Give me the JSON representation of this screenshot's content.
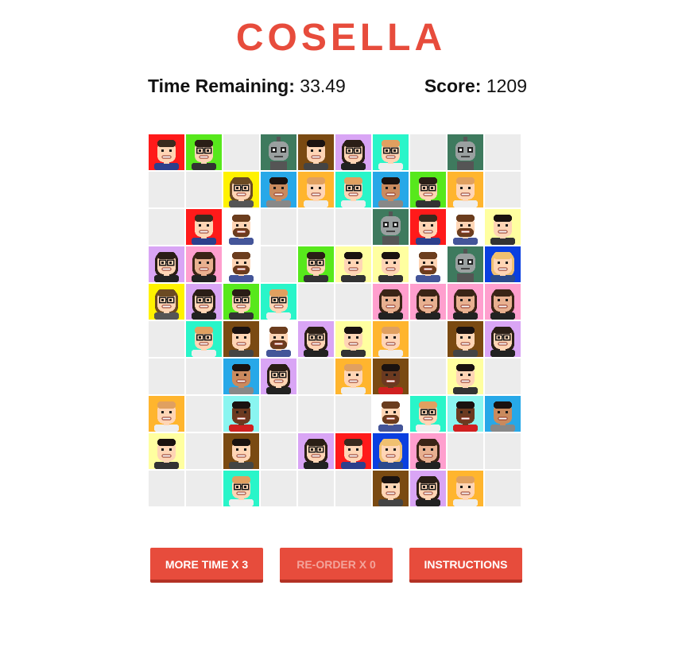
{
  "title": "COSELLA",
  "stats": {
    "time_label": "Time Remaining:",
    "time_value": "33.49",
    "score_label": "Score:",
    "score_value": "1209"
  },
  "buttons": {
    "more_time": "MORE TIME X 3",
    "reorder": "RE-ORDER X 0",
    "instructions": "INSTRUCTIONS"
  },
  "avatars": {
    "A": {
      "bg": "#ff1a1a",
      "skin": "#ffd5b5",
      "hair": "#3a2a1e",
      "shirt": "#2d3f8c",
      "glasses": false,
      "beard": false,
      "robot": false,
      "longhair": false,
      "name": "bald-guy-red-avatar"
    },
    "B": {
      "bg": "#57e81c",
      "skin": "#ffd5b5",
      "hair": "#2a1e16",
      "shirt": "#333333",
      "glasses": true,
      "beard": false,
      "robot": false,
      "longhair": false,
      "name": "glasses-guy-green-avatar"
    },
    "C": {
      "bg": "#3e7a5e",
      "skin": "#9aa0a0",
      "hair": "#6b6b6b",
      "shirt": "#555555",
      "glasses": false,
      "beard": false,
      "robot": true,
      "longhair": false,
      "name": "robot-avatar"
    },
    "D": {
      "bg": "#7a4a12",
      "skin": "#ffd5b5",
      "hair": "#1a1210",
      "shirt": "#444444",
      "glasses": false,
      "beard": false,
      "robot": false,
      "longhair": false,
      "name": "spiky-hair-guy-brown-avatar"
    },
    "E": {
      "bg": "#d9a5f5",
      "skin": "#ffd5b5",
      "hair": "#2a1e16",
      "shirt": "#222222",
      "glasses": true,
      "beard": false,
      "robot": false,
      "longhair": true,
      "name": "glasses-woman-purple-avatar"
    },
    "F": {
      "bg": "#29f5c9",
      "skin": "#ffd5b5",
      "hair": "#e0a060",
      "shirt": "#eeeeee",
      "glasses": true,
      "beard": false,
      "robot": false,
      "longhair": false,
      "name": "ginger-glasses-guy-teal-avatar"
    },
    "G": {
      "bg": "#fff200",
      "skin": "#ffd5b5",
      "hair": "#6b4a22",
      "shirt": "#555555",
      "glasses": true,
      "beard": false,
      "robot": false,
      "longhair": true,
      "name": "curly-woman-yellow-avatar"
    },
    "H": {
      "bg": "#27a8e8",
      "skin": "#c98a5e",
      "hair": "#1a1210",
      "shirt": "#888888",
      "glasses": false,
      "beard": false,
      "robot": false,
      "longhair": false,
      "name": "tan-guy-blue-avatar"
    },
    "I": {
      "bg": "#ffb52e",
      "skin": "#ffd5b5",
      "hair": "#e0a060",
      "shirt": "#eeeeee",
      "glasses": false,
      "beard": false,
      "robot": false,
      "longhair": false,
      "name": "blond-guy-orange-avatar"
    },
    "J": {
      "bg": "#ffffff",
      "skin": "#ffd5b5",
      "hair": "#6b3d1e",
      "shirt": "#445599",
      "glasses": false,
      "beard": true,
      "robot": false,
      "longhair": false,
      "name": "bearded-guy-white-avatar"
    },
    "K": {
      "bg": "#ffffa0",
      "skin": "#ffd5b5",
      "hair": "#1a1210",
      "shirt": "#333333",
      "glasses": false,
      "beard": false,
      "robot": false,
      "longhair": false,
      "name": "dark-hair-guy-cream-avatar"
    },
    "L": {
      "bg": "#ff9fce",
      "skin": "#e8b090",
      "hair": "#3a2416",
      "shirt": "#222222",
      "glasses": false,
      "beard": false,
      "robot": false,
      "longhair": true,
      "name": "long-hair-woman-pink-avatar"
    },
    "M": {
      "bg": "#0a3fe0",
      "skin": "#ffd5b5",
      "hair": "#f0c070",
      "shirt": "#2a4a8c",
      "glasses": false,
      "beard": false,
      "robot": false,
      "longhair": true,
      "name": "blonde-woman-blue-avatar"
    },
    "N": {
      "bg": "#7a4a12",
      "skin": "#6b3a20",
      "hair": "#1a1210",
      "shirt": "#d02020",
      "glasses": false,
      "beard": false,
      "robot": false,
      "longhair": false,
      "name": "dark-skin-guy-brown-avatar"
    },
    "O": {
      "bg": "#8af5f0",
      "skin": "#6b3a20",
      "hair": "#1a1210",
      "shirt": "#d02020",
      "glasses": false,
      "beard": false,
      "robot": false,
      "longhair": false,
      "name": "dark-skin-guy-cyan-avatar"
    }
  },
  "grid": [
    [
      "A",
      "B",
      "",
      "C",
      "D",
      "E",
      "F",
      "",
      "C",
      ""
    ],
    [
      "",
      "",
      "G",
      "H",
      "I",
      "F",
      "H",
      "B",
      "I",
      ""
    ],
    [
      "",
      "A",
      "J",
      "",
      "",
      "",
      "C",
      "A",
      "J",
      "K"
    ],
    [
      "E",
      "L",
      "J",
      "",
      "B",
      "K",
      "K",
      "J",
      "C",
      "M"
    ],
    [
      "G",
      "E",
      "B",
      "F",
      "",
      "",
      "L",
      "L",
      "L",
      "L"
    ],
    [
      "",
      "F",
      "D",
      "J",
      "E",
      "K",
      "I",
      "",
      "D",
      "E"
    ],
    [
      "",
      "",
      "H",
      "E",
      "",
      "I",
      "N",
      "",
      "K",
      ""
    ],
    [
      "I",
      "",
      "O",
      "",
      "",
      "",
      "J",
      "F",
      "O",
      "H"
    ],
    [
      "K",
      "",
      "D",
      "",
      "E",
      "A",
      "M",
      "L",
      "",
      ""
    ],
    [
      "",
      "",
      "F",
      "",
      "",
      "",
      "D",
      "E",
      "I",
      ""
    ]
  ]
}
